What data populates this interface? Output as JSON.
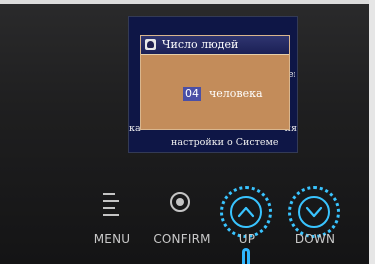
{
  "screen": {
    "dialog": {
      "title": "Число людей",
      "value": "04",
      "unit": "человека"
    },
    "background_fragments": {
      "right": "ей",
      "left_bottom": "ка",
      "right_bottom": "ия",
      "bottom": "настройки о Системе"
    }
  },
  "controls": {
    "menu_label": "MENU",
    "confirm_label": "CONFIRM",
    "up_label": "UP",
    "down_label": "DOWN"
  },
  "colors": {
    "screen_background": "#0e1646",
    "dialog_background": "#c38c5a",
    "dialog_header": "#1b2055",
    "value_highlight": "#4a4fa6",
    "active_ring": "#39c4ff",
    "button_label": "#c9c9c9"
  },
  "icons": {
    "menu": "hamburger-icon",
    "confirm": "record-circle-icon",
    "up": "chevron-up-icon",
    "down": "chevron-down-icon",
    "dialog": "people-icon"
  }
}
